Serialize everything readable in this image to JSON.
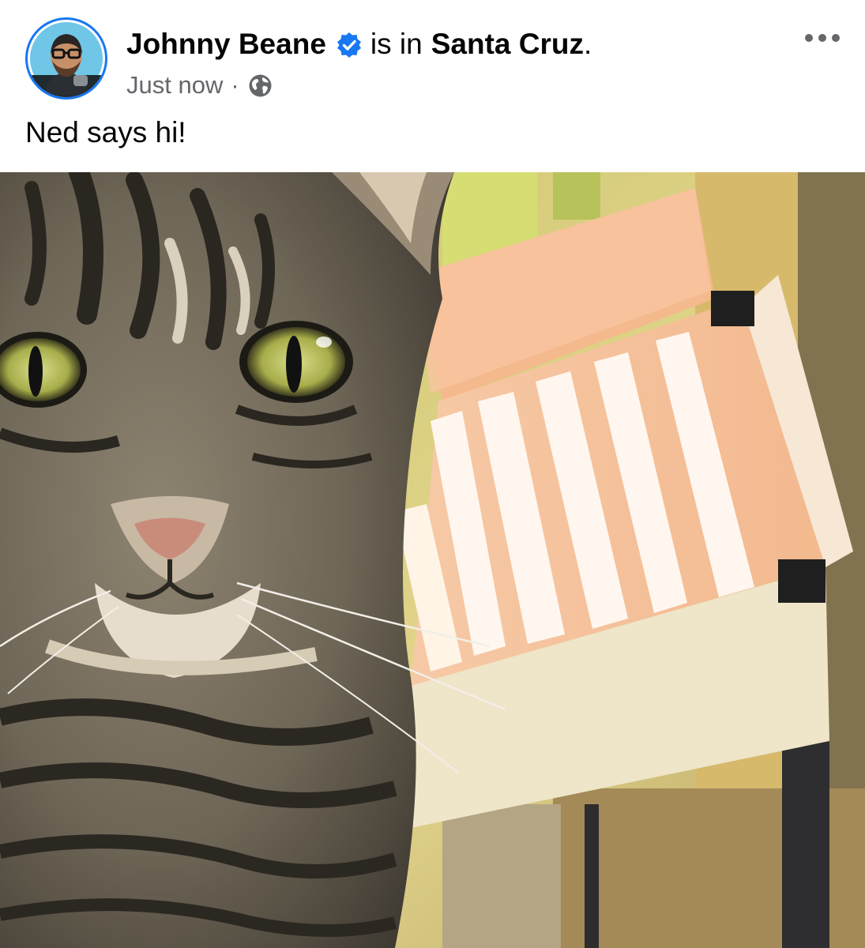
{
  "post": {
    "author": {
      "name": "Johnny Beane",
      "verified_icon": "verified-badge-icon",
      "avatar_alt": "profile photo"
    },
    "location_connector": "is in",
    "location": "Santa Cruz",
    "location_suffix": ".",
    "timestamp": "Just now",
    "separator": "·",
    "audience_icon": "globe-icon",
    "more_icon": "more-options-icon",
    "text": "Ned says hi!",
    "photo": {
      "subject": "tabby cat close-up beside a lit studio light panel"
    }
  },
  "colors": {
    "accent": "#1877f2",
    "secondary_text": "#65676b",
    "primary_text": "#050505"
  }
}
